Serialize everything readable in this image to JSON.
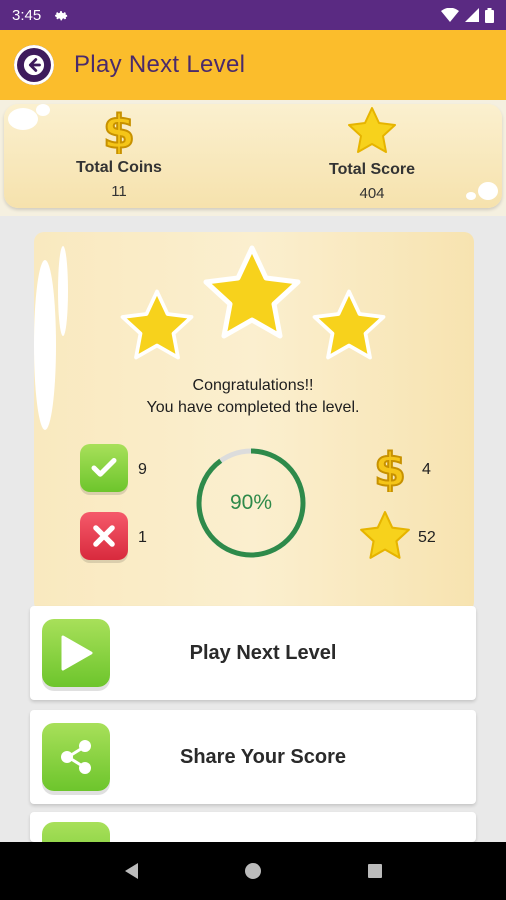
{
  "status_bar": {
    "time": "3:45"
  },
  "app_bar": {
    "title": "Play Next Level",
    "back_icon": "arrow-left-icon"
  },
  "totals": {
    "coins_label": "Total Coins",
    "coins_value": "11",
    "score_label": "Total Score",
    "score_value": "404"
  },
  "result": {
    "stars": 3,
    "message_line1": "Congratulations!!",
    "message_line2": "You have completed the level.",
    "correct_count": "9",
    "wrong_count": "1",
    "accuracy_label": "90%",
    "accuracy_fraction": 0.9,
    "coins_earned": "4",
    "score_earned": "52"
  },
  "actions": [
    {
      "label": "Play Next Level",
      "icon": "play-icon"
    },
    {
      "label": "Share Your Score",
      "icon": "share-icon"
    }
  ],
  "colors": {
    "status_bar": "#5a2a82",
    "app_bar": "#fbbd2c",
    "title_text": "#4a2a6b",
    "progress": "#2e8a4a",
    "button_green": "#6dc52c"
  }
}
